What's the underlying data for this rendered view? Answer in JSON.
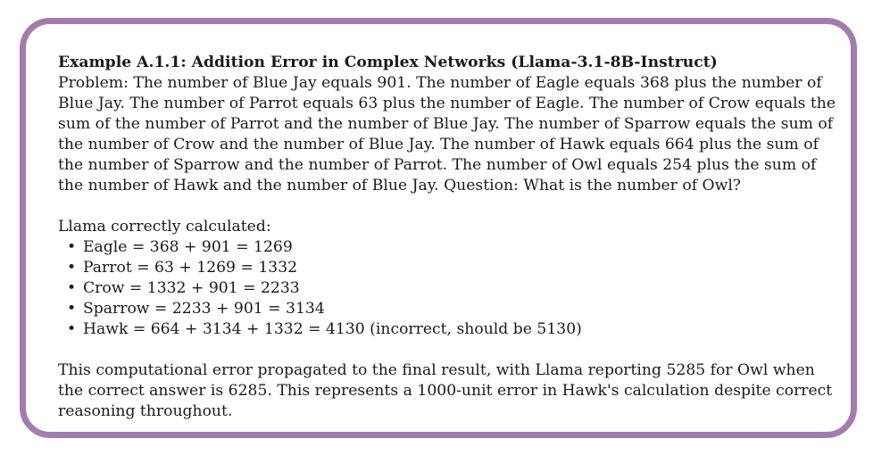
{
  "example": {
    "title": "Example A.1.1: Addition Error in Complex Networks (Llama-3.1-8B-Instruct)",
    "problem": "Problem: The number of Blue Jay equals 901. The number of Eagle equals 368 plus the number of Blue Jay. The number of Parrot equals 63 plus the number of Eagle. The number of Crow equals the sum of the number of Parrot and the number of Blue Jay. The number of Sparrow equals the sum of the number of Crow and the number of Blue Jay. The number of Hawk equals 664 plus the sum of the number of Sparrow and the number of Parrot. The number of Owl equals 254 plus the sum of the number of Hawk and the number of Blue Jay. Question: What is the number of Owl?",
    "calc_intro": "Llama correctly calculated:",
    "steps": [
      "Eagle = 368 + 901 = 1269",
      "Parrot = 63 + 1269 = 1332",
      "Crow = 1332 + 901 = 2233",
      "Sparrow = 2233 + 901 = 3134",
      "Hawk = 664 + 3134 + 1332 = 4130 (incorrect, should be 5130)"
    ],
    "bullet_symbol": "•",
    "conclusion": "This computational error propagated to the final result, with Llama reporting 5285 for Owl when the correct answer is 6285. This represents a 1000-unit error in Hawk's calculation despite correct reasoning throughout."
  },
  "colors": {
    "border": "#a27dab",
    "text": "#1a1a1a"
  }
}
